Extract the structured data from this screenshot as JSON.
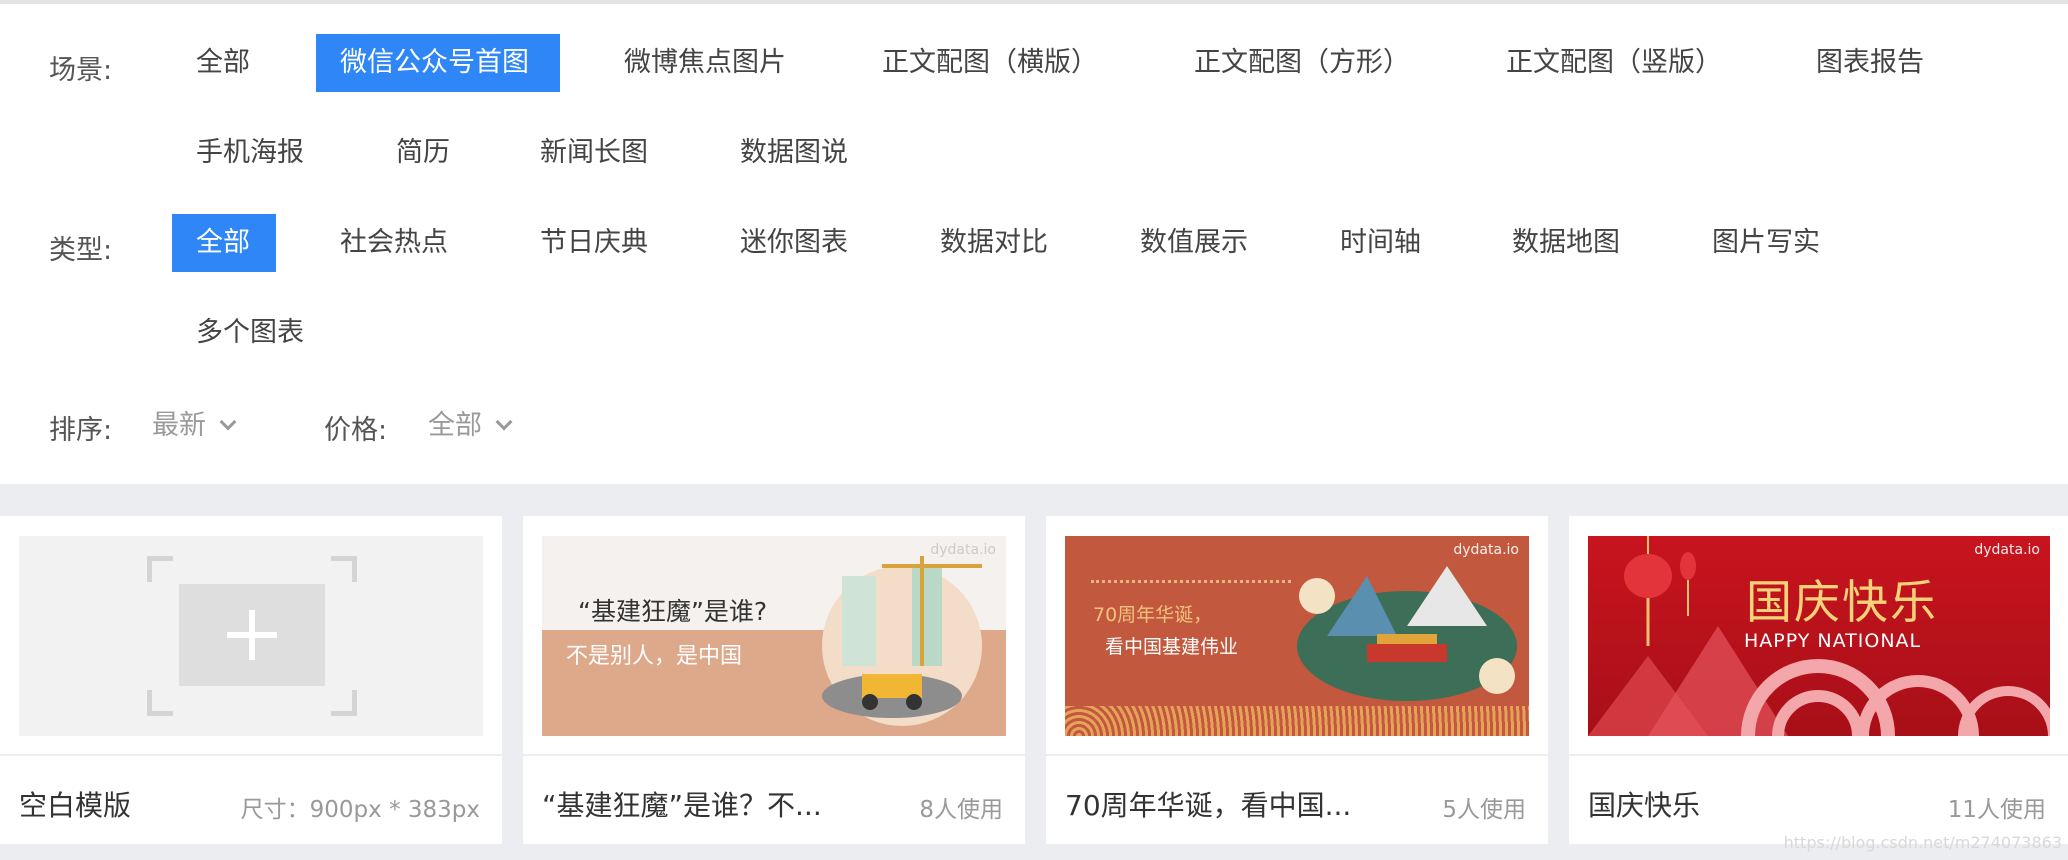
{
  "filters": {
    "scene": {
      "label": "场景:",
      "options": [
        "全部",
        "微信公众号首图",
        "微博焦点图片",
        "正文配图（横版）",
        "正文配图（方形）",
        "正文配图（竖版）",
        "图表报告",
        "手机海报",
        "简历",
        "新闻长图",
        "数据图说"
      ],
      "selected": "微信公众号首图"
    },
    "type": {
      "label": "类型:",
      "options": [
        "全部",
        "社会热点",
        "节日庆典",
        "迷你图表",
        "数据对比",
        "数值展示",
        "时间轴",
        "数据地图",
        "图片写实",
        "多个图表"
      ],
      "selected": "全部"
    },
    "sort": {
      "label": "排序:",
      "value": "最新"
    },
    "price": {
      "label": "价格:",
      "value": "全部"
    }
  },
  "cards": [
    {
      "title": "空白模版",
      "meta": "尺寸：900px * 383px"
    },
    {
      "title": "“基建狂魔”是谁？不...",
      "meta": "8人使用",
      "banner_line1": "“基建狂魔”是谁?",
      "banner_line2": "不是别人，是中国",
      "watermark": "dydata.io"
    },
    {
      "title": "70周年华诞，看中国...",
      "meta": "5人使用",
      "banner_line1": "70周年华诞，",
      "banner_line2": "看中国基建伟业",
      "watermark": "dydata.io"
    },
    {
      "title": "国庆快乐",
      "meta": "11人使用",
      "banner_line1": "国庆快乐",
      "banner_line2": "HAPPY NATIONAL",
      "watermark": "dydata.io"
    }
  ],
  "page_watermark": "https://blog.csdn.net/m274073863",
  "colors": {
    "accent": "#2f86f6",
    "card2_bg": "#dea98a",
    "card3_bg": "#c2593e",
    "card4_bg": "#c8141e"
  }
}
